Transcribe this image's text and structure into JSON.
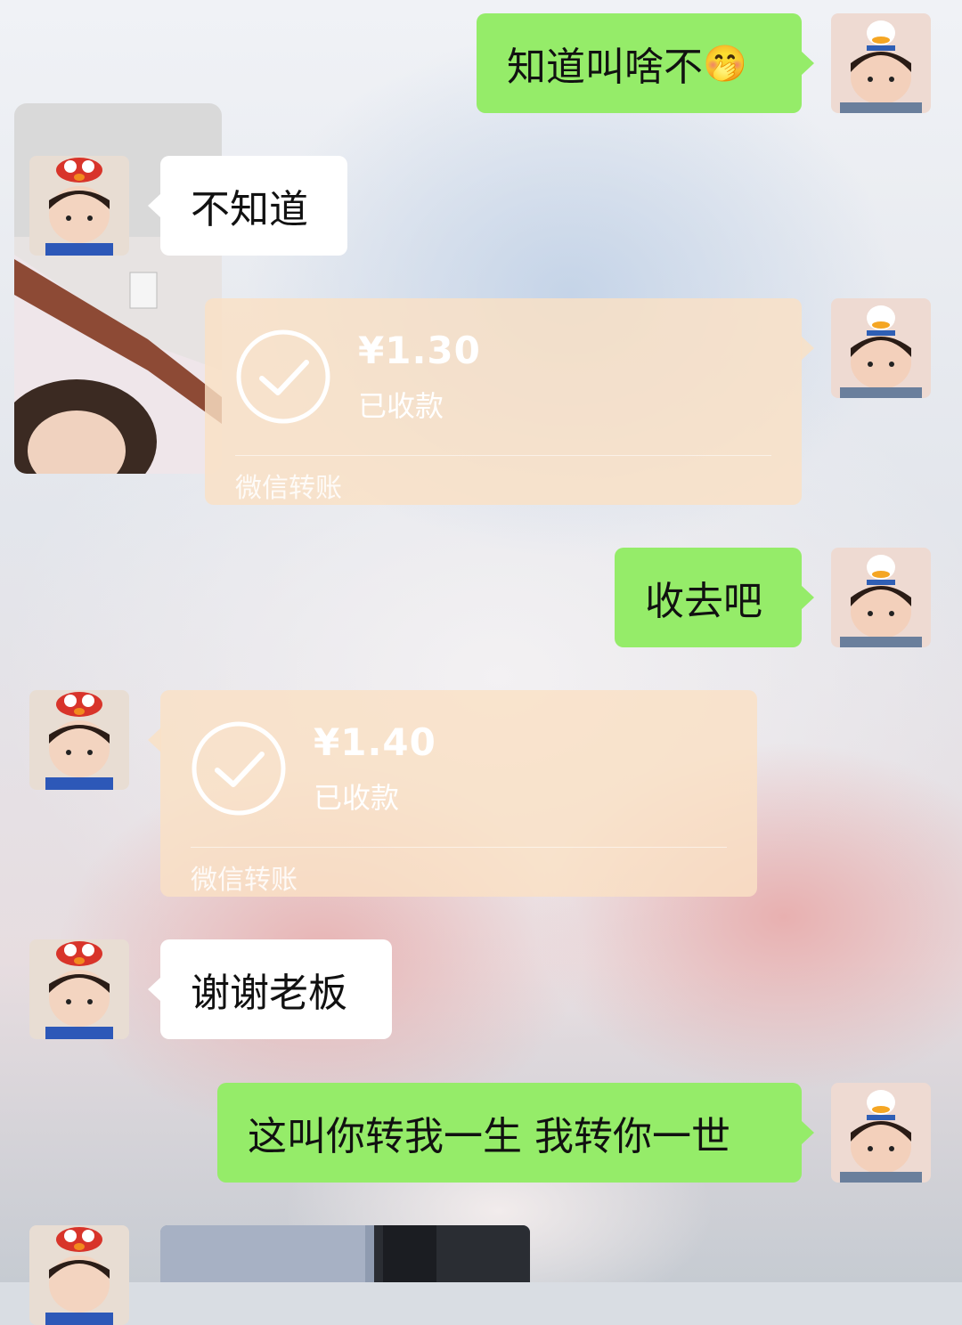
{
  "messages": [
    {
      "side": "right",
      "type": "text",
      "text": "知道叫啥不",
      "emoji": "🤭"
    },
    {
      "side": "left",
      "type": "text",
      "text": "不知道"
    },
    {
      "side": "right",
      "type": "transfer",
      "amount": "¥1.30",
      "status": "已收款",
      "footer": "微信转账"
    },
    {
      "side": "right",
      "type": "text",
      "text": "收去吧"
    },
    {
      "side": "left",
      "type": "transfer",
      "amount": "¥1.40",
      "status": "已收款",
      "footer": "微信转账"
    },
    {
      "side": "left",
      "type": "text",
      "text": "谢谢老板"
    },
    {
      "side": "right",
      "type": "text",
      "text": "这叫你转我一生 我转你一世"
    },
    {
      "side": "left",
      "type": "image"
    }
  ],
  "colors": {
    "sent_bubble": "#95ec69",
    "received_bubble": "#ffffff",
    "transfer_card": "#fae1c4"
  }
}
